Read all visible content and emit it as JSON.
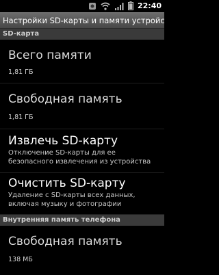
{
  "status": {
    "time": "22:40",
    "icons": [
      "notification-icon",
      "wifi-icon",
      "signal-icon",
      "battery-icon"
    ]
  },
  "title": "Настройки SD-карты и памяти устройства",
  "sections": [
    {
      "header": "SD-карта",
      "items": [
        {
          "title": "Всего памяти",
          "value": "1,81 ГБ"
        },
        {
          "title": "Свободная память",
          "value": "1,81 ГБ"
        },
        {
          "title": "Извлечь SD-карту",
          "summary": "Отключение SD-карты для ее безопасного извлечения из устройства"
        },
        {
          "title": "Очистить SD-карту",
          "summary": "Удаление с SD-карты всех данных, включая музыку и фотографии"
        }
      ]
    },
    {
      "header": "Внутренняя память телефона",
      "items": [
        {
          "title": "Свободная память",
          "value": "138 МБ"
        }
      ]
    }
  ],
  "colors": {
    "background": "#000000",
    "titlebar": "#5a5a5a",
    "section_header": "#3a3a3a"
  }
}
